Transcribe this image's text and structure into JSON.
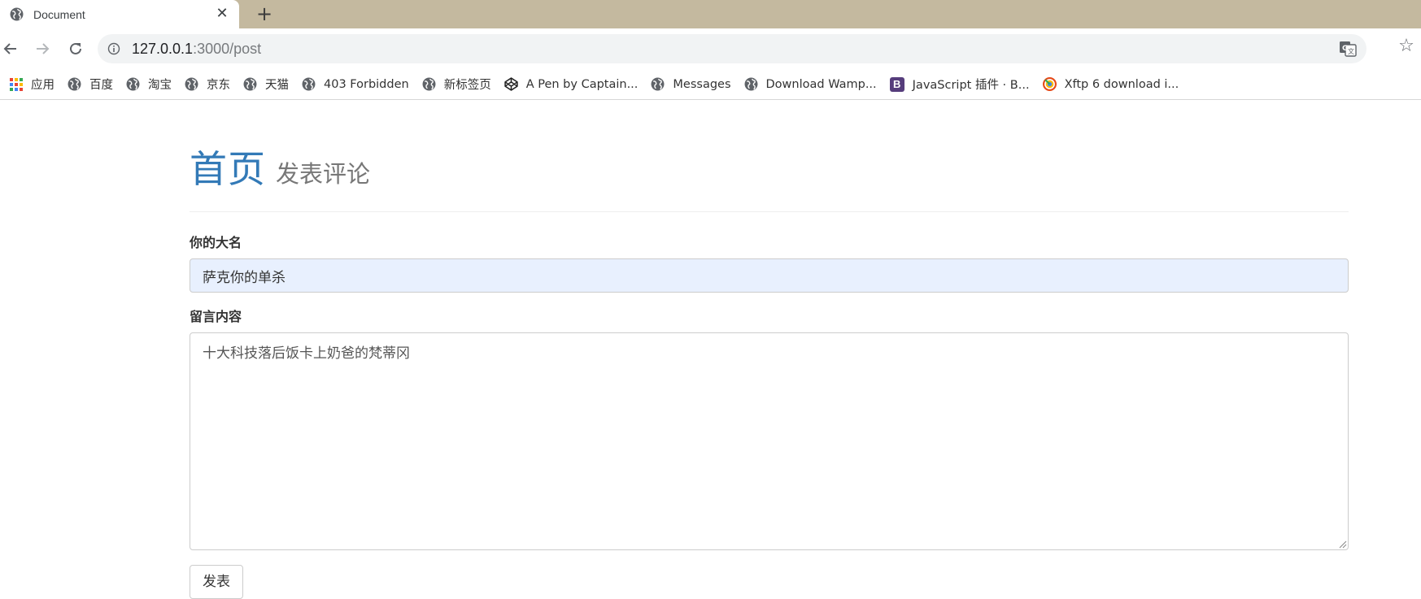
{
  "browser": {
    "tab": {
      "title": "Document",
      "close_glyph": "✕"
    },
    "new_tab_glyph": "+",
    "url_host": "127.0.0.1",
    "url_path": ":3000/post",
    "star_glyph": "☆",
    "bookmarks": [
      {
        "label": "应用",
        "icon": "apps-grid-icon"
      },
      {
        "label": "百度",
        "icon": "globe-icon"
      },
      {
        "label": "淘宝",
        "icon": "globe-icon"
      },
      {
        "label": "京东",
        "icon": "globe-icon"
      },
      {
        "label": "天猫",
        "icon": "globe-icon"
      },
      {
        "label": "403 Forbidden",
        "icon": "globe-icon"
      },
      {
        "label": "新标签页",
        "icon": "globe-icon"
      },
      {
        "label": "A Pen by Captain...",
        "icon": "codepen-icon"
      },
      {
        "label": "Messages",
        "icon": "globe-icon"
      },
      {
        "label": "Download Wamp...",
        "icon": "globe-icon"
      },
      {
        "label": "JavaScript 插件 · B...",
        "icon": "bootstrap-icon",
        "badge": "B"
      },
      {
        "label": "Xftp 6 download i...",
        "icon": "xftp-icon"
      }
    ]
  },
  "page": {
    "header_home": "首页",
    "header_sub": "发表评论",
    "name_label": "你的大名",
    "name_value": "萨克你的单杀",
    "message_label": "留言内容",
    "message_value": "十大科技落后饭卡上奶爸的梵蒂冈",
    "submit_label": "发表"
  },
  "colors": {
    "tabstrip": "#c4b99f",
    "link_blue": "#337ab7",
    "autofill": "#e8f0fe",
    "bootstrap_purple": "#563d7c"
  }
}
